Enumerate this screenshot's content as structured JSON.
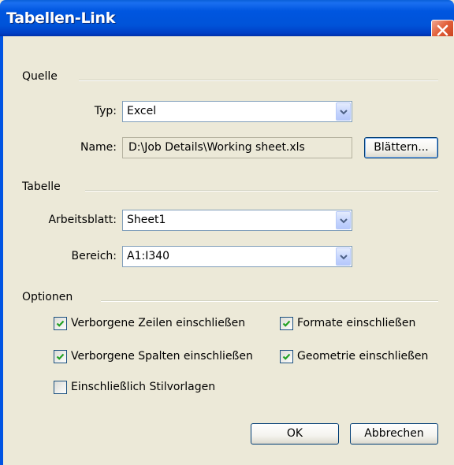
{
  "window": {
    "title": "Tabellen-Link"
  },
  "source": {
    "group_label": "Quelle",
    "type_label": "Typ:",
    "type_value": "Excel",
    "name_label": "Name:",
    "name_value": "D:\\Job Details\\Working sheet.xls",
    "browse_label": "Blättern..."
  },
  "table": {
    "group_label": "Tabelle",
    "sheet_label": "Arbeitsblatt:",
    "sheet_value": "Sheet1",
    "range_label": "Bereich:",
    "range_value": "A1:I340"
  },
  "options": {
    "group_label": "Optionen",
    "items": [
      {
        "label": "Verborgene Zeilen einschließen",
        "checked": true
      },
      {
        "label": "Formate einschließen",
        "checked": true
      },
      {
        "label": "Verborgene Spalten einschließen",
        "checked": true
      },
      {
        "label": "Geometrie einschließen",
        "checked": true
      },
      {
        "label": "Einschließlich Stilvorlagen",
        "checked": false
      }
    ]
  },
  "buttons": {
    "ok": "OK",
    "cancel": "Abbrechen"
  },
  "colors": {
    "titlebar": "#0054e3",
    "dialog_bg": "#ece9d8",
    "check_green": "#21a121",
    "close_red": "#e2603a"
  }
}
